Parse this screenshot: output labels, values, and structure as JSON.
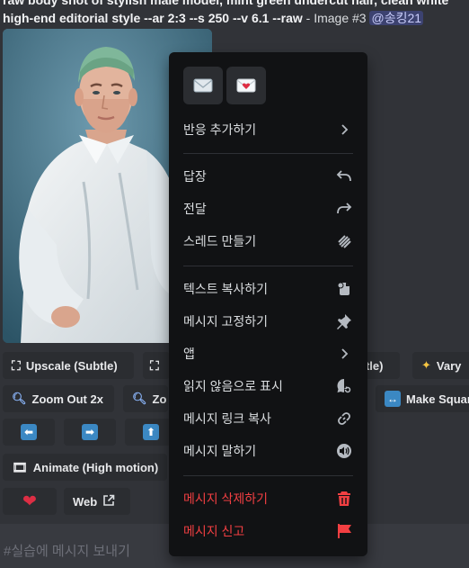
{
  "message": {
    "prompt_top": "raw body shot of stylish male model, mint green undercut hair, clean white",
    "prompt_second": "high-end editorial style --ar 2:3 --s 250 --v 6.1 --raw",
    "separator": " - ",
    "image_label": "Image #3",
    "mention": "@송킹21"
  },
  "buttons": {
    "upscale_subtle": "Upscale (Subtle)",
    "subtle_fragment": "btle)",
    "vary": "Vary",
    "zoom_out_2x": "Zoom Out 2x",
    "zoom_partial": "Zo",
    "make_square": "Make Squar",
    "animate": "Animate (High motion)",
    "web": "Web"
  },
  "context_menu": {
    "reactions": [
      "envelope-icon",
      "heart-letter-icon"
    ],
    "add_reaction": "반응 추가하기",
    "reply": "답장",
    "forward": "전달",
    "create_thread": "스레드 만들기",
    "copy_text": "텍스트 복사하기",
    "pin_message": "메시지 고정하기",
    "apps": "앱",
    "mark_unread": "읽지 않음으로 표시",
    "copy_link": "메시지 링크 복사",
    "speak_message": "메시지 말하기",
    "delete_message": "메시지 삭제하기",
    "report_message": "메시지 신고"
  },
  "chat_input": {
    "placeholder": "#실습에 메시지 보내기"
  },
  "colors": {
    "background": "#313338",
    "menu": "#111214",
    "danger": "#f23f42",
    "mention_bg": "#3c4270"
  }
}
